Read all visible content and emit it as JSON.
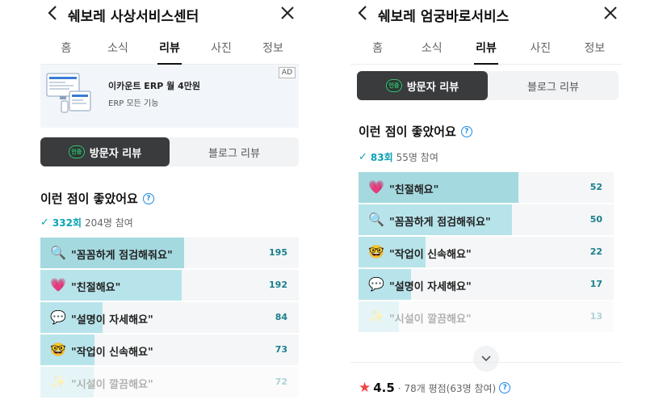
{
  "left": {
    "title": "쉐보레 사상서비스센터",
    "tabs": [
      "홈",
      "소식",
      "리뷰",
      "사진",
      "정보"
    ],
    "active_tab": "리뷰",
    "ad": {
      "title": "이카운트 ERP 월 4만원",
      "subtitle": "ERP 모든 기능",
      "badge": "AD"
    },
    "toggle": {
      "visitor": "방문자 리뷰",
      "blog": "블로그 리뷰",
      "badge_text": "인증"
    },
    "section_title": "이런 점이 좋았어요",
    "stats": {
      "count": "332회",
      "participants": "204명 참여"
    },
    "items": [
      {
        "emoji": "🔍",
        "label": "\"꼼꼼하게 점검해줘요\"",
        "count": "195",
        "ratio": 1.0
      },
      {
        "emoji": "💗",
        "label": "\"친절해요\"",
        "count": "192",
        "ratio": 0.985
      },
      {
        "emoji": "💬",
        "label": "\"설명이 자세해요\"",
        "count": "84",
        "ratio": 0.43
      },
      {
        "emoji": "🤓",
        "label": "\"작업이 신속해요\"",
        "count": "73",
        "ratio": 0.374
      },
      {
        "emoji": "✨",
        "label": "\"시설이 깔끔해요\"",
        "count": "72",
        "ratio": 0.369
      }
    ]
  },
  "right": {
    "title": "쉐보레 엄궁바로서비스",
    "tabs": [
      "홈",
      "소식",
      "리뷰",
      "사진",
      "정보"
    ],
    "active_tab": "리뷰",
    "toggle": {
      "visitor": "방문자 리뷰",
      "blog": "블로그 리뷰",
      "badge_text": "인증"
    },
    "section_title": "이런 점이 좋았어요",
    "stats": {
      "count": "83회",
      "participants": "55명 참여"
    },
    "items": [
      {
        "emoji": "💗",
        "label": "\"친절해요\"",
        "count": "52",
        "ratio": 1.0
      },
      {
        "emoji": "🔍",
        "label": "\"꼼꼼하게 점검해줘요\"",
        "count": "50",
        "ratio": 0.96
      },
      {
        "emoji": "🤓",
        "label": "\"작업이 신속해요\"",
        "count": "22",
        "ratio": 0.42
      },
      {
        "emoji": "💬",
        "label": "\"설명이 자세해요\"",
        "count": "17",
        "ratio": 0.33
      },
      {
        "emoji": "✨",
        "label": "\"시설이 깔끔해요\"",
        "count": "13",
        "ratio": 0.25
      }
    ],
    "rating": {
      "score": "4.5",
      "detail": "· 78개 평점(63명 참여)"
    }
  },
  "icons": {
    "back": "chevron-left-icon",
    "close": "close-icon",
    "help": "question-circle-icon",
    "check": "check-icon",
    "expand": "chevron-down-icon",
    "star": "star-icon"
  },
  "colors": {
    "accent": "#0aa3b4",
    "bar_fill": "#b7e4ea",
    "toggle_active": "#3a3b3d",
    "star": "#f04646",
    "help": "#1e88e5"
  }
}
